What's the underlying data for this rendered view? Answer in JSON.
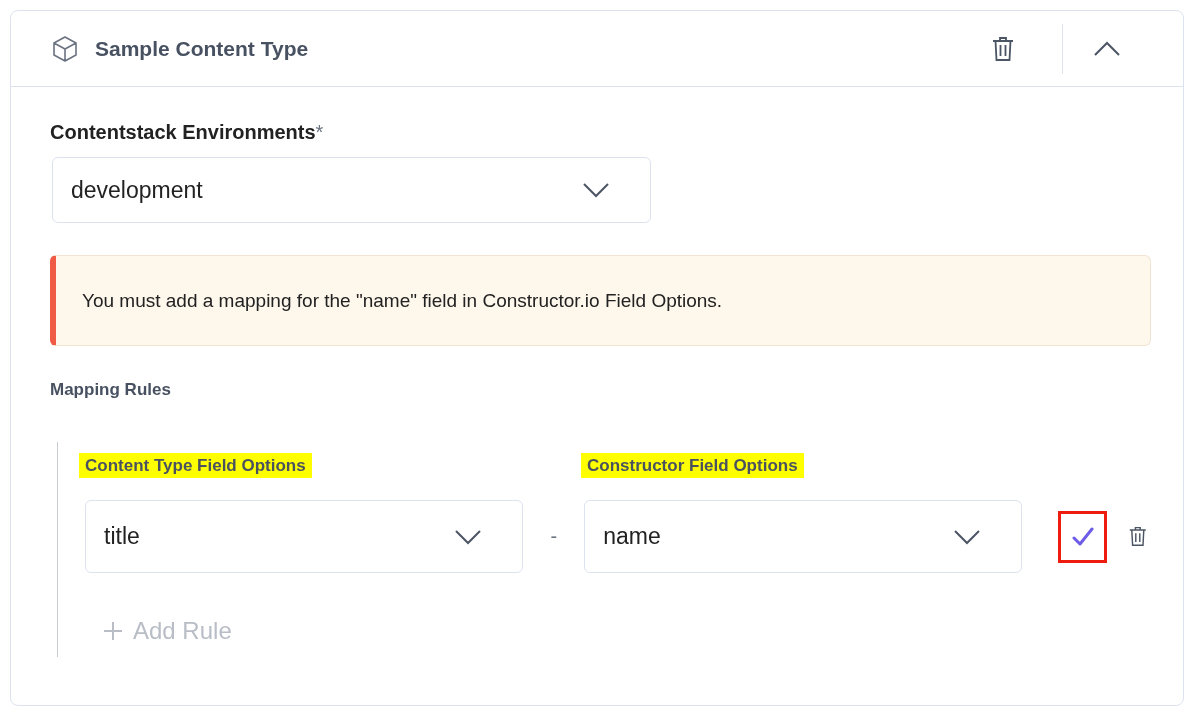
{
  "panel": {
    "title": "Sample Content Type",
    "expanded": true
  },
  "environment": {
    "label": "Contentstack Environments",
    "required_mark": "*",
    "value": "development"
  },
  "alert": {
    "kind": "error",
    "message": "You must add a mapping for the \"name\" field in Constructor.io Field Options."
  },
  "mapping": {
    "title": "Mapping Rules",
    "columns": [
      {
        "label": "Content Type Field Options",
        "highlighted": true
      },
      {
        "label": "Constructor Field Options",
        "highlighted": true
      }
    ],
    "rules": [
      {
        "source": "title",
        "separator": "-",
        "target": "name",
        "confirm_highlighted": true
      }
    ],
    "add_button": "Add Rule"
  }
}
